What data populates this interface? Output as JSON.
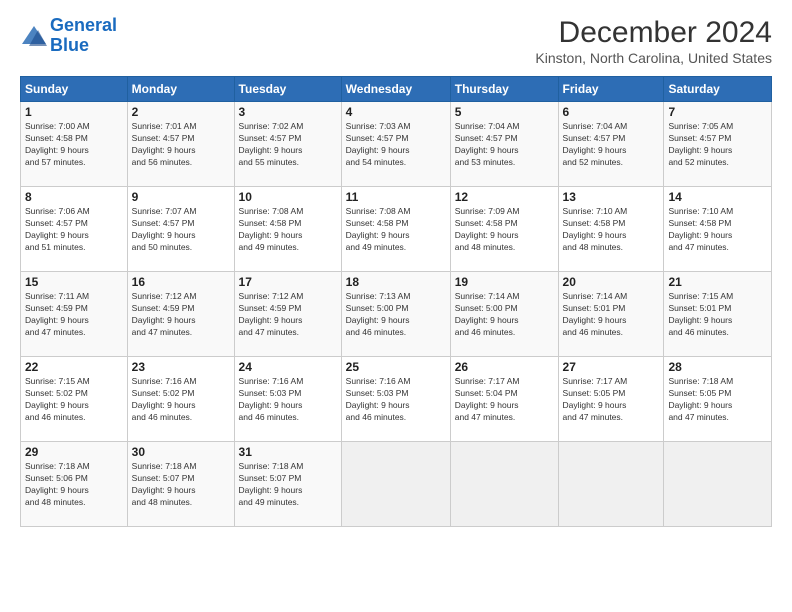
{
  "logo": {
    "line1": "General",
    "line2": "Blue"
  },
  "title": "December 2024",
  "subtitle": "Kinston, North Carolina, United States",
  "weekdays": [
    "Sunday",
    "Monday",
    "Tuesday",
    "Wednesday",
    "Thursday",
    "Friday",
    "Saturday"
  ],
  "weeks": [
    [
      {
        "day": "1",
        "info": "Sunrise: 7:00 AM\nSunset: 4:58 PM\nDaylight: 9 hours\nand 57 minutes."
      },
      {
        "day": "2",
        "info": "Sunrise: 7:01 AM\nSunset: 4:57 PM\nDaylight: 9 hours\nand 56 minutes."
      },
      {
        "day": "3",
        "info": "Sunrise: 7:02 AM\nSunset: 4:57 PM\nDaylight: 9 hours\nand 55 minutes."
      },
      {
        "day": "4",
        "info": "Sunrise: 7:03 AM\nSunset: 4:57 PM\nDaylight: 9 hours\nand 54 minutes."
      },
      {
        "day": "5",
        "info": "Sunrise: 7:04 AM\nSunset: 4:57 PM\nDaylight: 9 hours\nand 53 minutes."
      },
      {
        "day": "6",
        "info": "Sunrise: 7:04 AM\nSunset: 4:57 PM\nDaylight: 9 hours\nand 52 minutes."
      },
      {
        "day": "7",
        "info": "Sunrise: 7:05 AM\nSunset: 4:57 PM\nDaylight: 9 hours\nand 52 minutes."
      }
    ],
    [
      {
        "day": "8",
        "info": "Sunrise: 7:06 AM\nSunset: 4:57 PM\nDaylight: 9 hours\nand 51 minutes."
      },
      {
        "day": "9",
        "info": "Sunrise: 7:07 AM\nSunset: 4:57 PM\nDaylight: 9 hours\nand 50 minutes."
      },
      {
        "day": "10",
        "info": "Sunrise: 7:08 AM\nSunset: 4:58 PM\nDaylight: 9 hours\nand 49 minutes."
      },
      {
        "day": "11",
        "info": "Sunrise: 7:08 AM\nSunset: 4:58 PM\nDaylight: 9 hours\nand 49 minutes."
      },
      {
        "day": "12",
        "info": "Sunrise: 7:09 AM\nSunset: 4:58 PM\nDaylight: 9 hours\nand 48 minutes."
      },
      {
        "day": "13",
        "info": "Sunrise: 7:10 AM\nSunset: 4:58 PM\nDaylight: 9 hours\nand 48 minutes."
      },
      {
        "day": "14",
        "info": "Sunrise: 7:10 AM\nSunset: 4:58 PM\nDaylight: 9 hours\nand 47 minutes."
      }
    ],
    [
      {
        "day": "15",
        "info": "Sunrise: 7:11 AM\nSunset: 4:59 PM\nDaylight: 9 hours\nand 47 minutes."
      },
      {
        "day": "16",
        "info": "Sunrise: 7:12 AM\nSunset: 4:59 PM\nDaylight: 9 hours\nand 47 minutes."
      },
      {
        "day": "17",
        "info": "Sunrise: 7:12 AM\nSunset: 4:59 PM\nDaylight: 9 hours\nand 47 minutes."
      },
      {
        "day": "18",
        "info": "Sunrise: 7:13 AM\nSunset: 5:00 PM\nDaylight: 9 hours\nand 46 minutes."
      },
      {
        "day": "19",
        "info": "Sunrise: 7:14 AM\nSunset: 5:00 PM\nDaylight: 9 hours\nand 46 minutes."
      },
      {
        "day": "20",
        "info": "Sunrise: 7:14 AM\nSunset: 5:01 PM\nDaylight: 9 hours\nand 46 minutes."
      },
      {
        "day": "21",
        "info": "Sunrise: 7:15 AM\nSunset: 5:01 PM\nDaylight: 9 hours\nand 46 minutes."
      }
    ],
    [
      {
        "day": "22",
        "info": "Sunrise: 7:15 AM\nSunset: 5:02 PM\nDaylight: 9 hours\nand 46 minutes."
      },
      {
        "day": "23",
        "info": "Sunrise: 7:16 AM\nSunset: 5:02 PM\nDaylight: 9 hours\nand 46 minutes."
      },
      {
        "day": "24",
        "info": "Sunrise: 7:16 AM\nSunset: 5:03 PM\nDaylight: 9 hours\nand 46 minutes."
      },
      {
        "day": "25",
        "info": "Sunrise: 7:16 AM\nSunset: 5:03 PM\nDaylight: 9 hours\nand 46 minutes."
      },
      {
        "day": "26",
        "info": "Sunrise: 7:17 AM\nSunset: 5:04 PM\nDaylight: 9 hours\nand 47 minutes."
      },
      {
        "day": "27",
        "info": "Sunrise: 7:17 AM\nSunset: 5:05 PM\nDaylight: 9 hours\nand 47 minutes."
      },
      {
        "day": "28",
        "info": "Sunrise: 7:18 AM\nSunset: 5:05 PM\nDaylight: 9 hours\nand 47 minutes."
      }
    ],
    [
      {
        "day": "29",
        "info": "Sunrise: 7:18 AM\nSunset: 5:06 PM\nDaylight: 9 hours\nand 48 minutes."
      },
      {
        "day": "30",
        "info": "Sunrise: 7:18 AM\nSunset: 5:07 PM\nDaylight: 9 hours\nand 48 minutes."
      },
      {
        "day": "31",
        "info": "Sunrise: 7:18 AM\nSunset: 5:07 PM\nDaylight: 9 hours\nand 49 minutes."
      },
      {
        "day": "",
        "info": ""
      },
      {
        "day": "",
        "info": ""
      },
      {
        "day": "",
        "info": ""
      },
      {
        "day": "",
        "info": ""
      }
    ]
  ]
}
